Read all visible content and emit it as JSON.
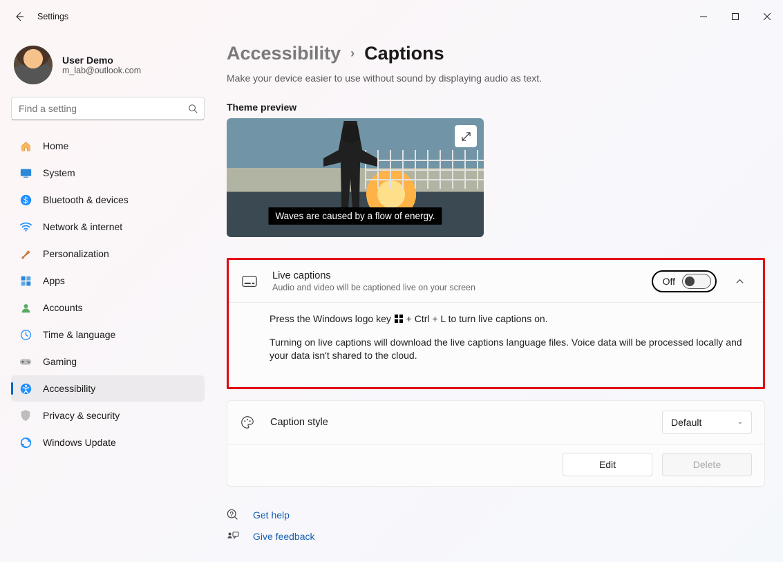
{
  "window": {
    "title": "Settings"
  },
  "profile": {
    "name": "User Demo",
    "email": "m_lab@outlook.com"
  },
  "search": {
    "placeholder": "Find a setting"
  },
  "sidebar": {
    "items": [
      {
        "label": "Home"
      },
      {
        "label": "System"
      },
      {
        "label": "Bluetooth & devices"
      },
      {
        "label": "Network & internet"
      },
      {
        "label": "Personalization"
      },
      {
        "label": "Apps"
      },
      {
        "label": "Accounts"
      },
      {
        "label": "Time & language"
      },
      {
        "label": "Gaming"
      },
      {
        "label": "Accessibility"
      },
      {
        "label": "Privacy & security"
      },
      {
        "label": "Windows Update"
      }
    ]
  },
  "breadcrumb": {
    "parent": "Accessibility",
    "current": "Captions"
  },
  "subtitle": "Make your device easier to use without sound by displaying audio as text.",
  "theme": {
    "label": "Theme preview",
    "caption": "Waves are caused by a flow of energy."
  },
  "live": {
    "title": "Live captions",
    "desc": "Audio and video will be captioned live on your screen",
    "state": "Off",
    "tip_prefix": "Press the Windows logo key ",
    "tip_suffix": " + Ctrl + L to turn live captions on.",
    "note": "Turning on live captions will download the live captions language files. Voice data will be processed locally and your data isn't shared to the cloud."
  },
  "style": {
    "title": "Caption style",
    "value": "Default",
    "edit": "Edit",
    "delete": "Delete"
  },
  "footer": {
    "help": "Get help",
    "feedback": "Give feedback"
  }
}
